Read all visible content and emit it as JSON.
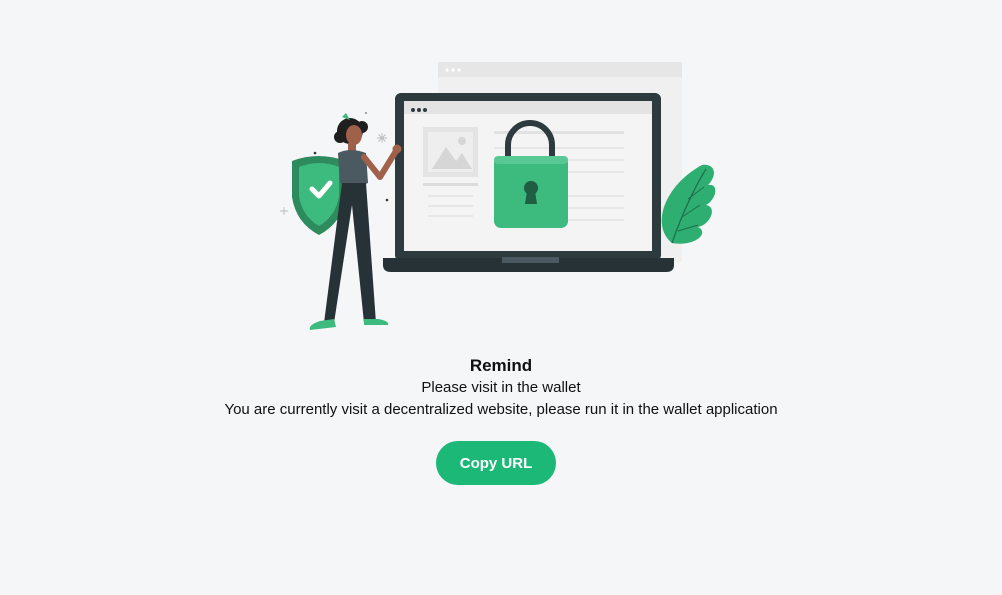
{
  "colors": {
    "background": "#f5f6f8",
    "accent": "#1cb878",
    "text": "#111111"
  },
  "illustration": {
    "icon": "security-lock-illustration"
  },
  "remind": {
    "title": "Remind",
    "subtitle": "Please visit in the wallet",
    "message": "You are currently visit a decentralized website, please run it in the wallet application"
  },
  "actions": {
    "copy_url_label": "Copy URL"
  }
}
